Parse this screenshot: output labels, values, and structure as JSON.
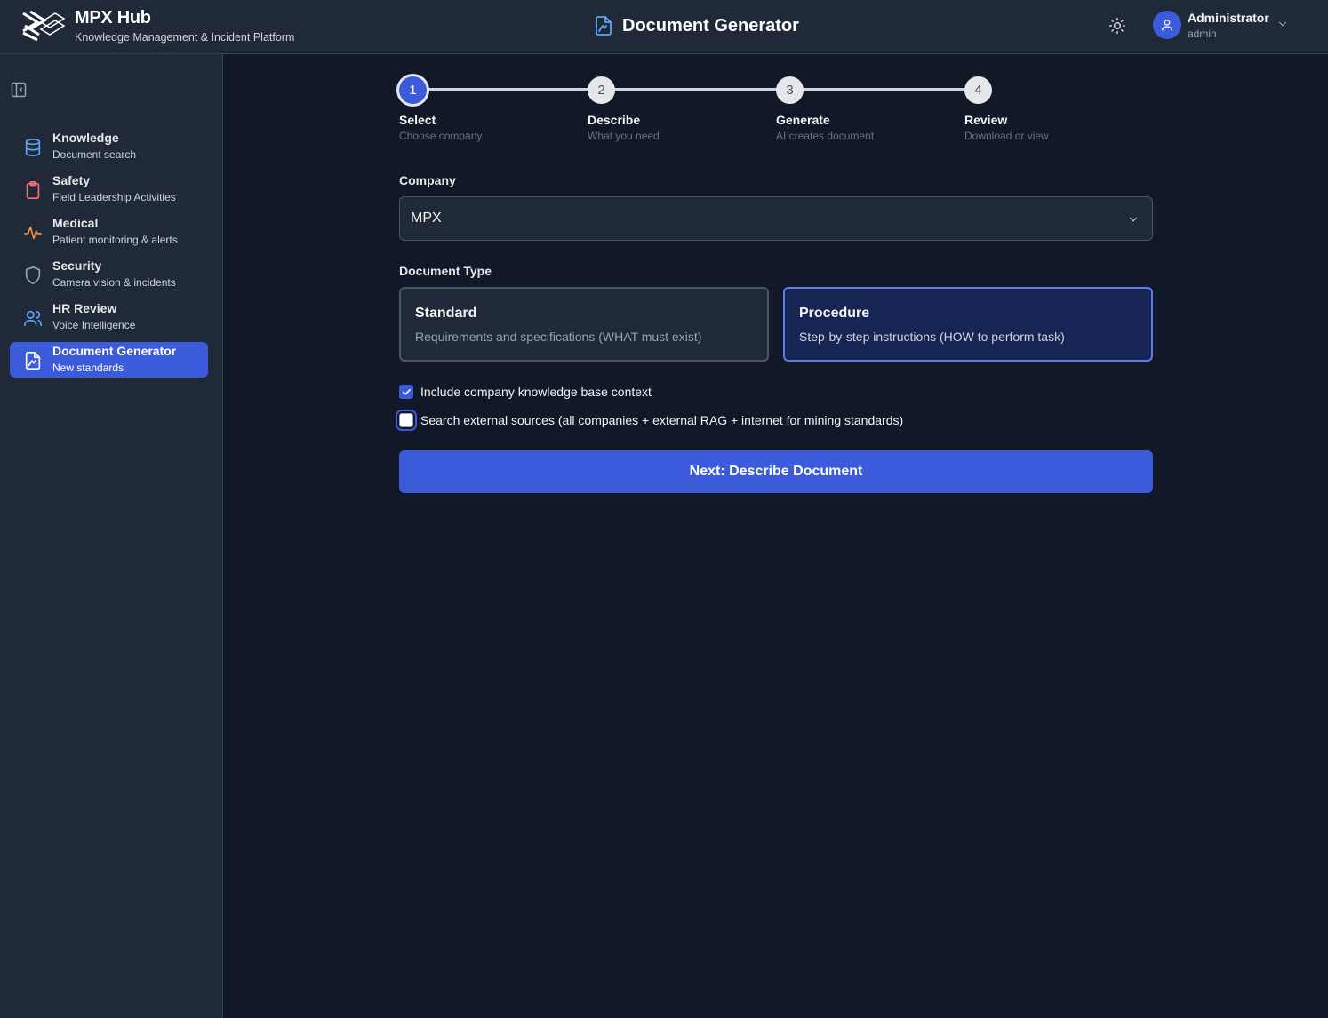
{
  "header": {
    "brand_title": "MPX Hub",
    "brand_subtitle": "Knowledge Management & Incident Platform",
    "page_title": "Document Generator",
    "user_name": "Administrator",
    "user_role": "admin"
  },
  "sidebar": {
    "items": [
      {
        "label": "Knowledge",
        "sub": "Document search",
        "icon": "database-icon",
        "color": "#60a5fa"
      },
      {
        "label": "Safety",
        "sub": "Field Leadership Activities",
        "icon": "clipboard-icon",
        "color": "#f87171"
      },
      {
        "label": "Medical",
        "sub": "Patient monitoring & alerts",
        "icon": "pulse-icon",
        "color": "#fb923c"
      },
      {
        "label": "Security",
        "sub": "Camera vision & incidents",
        "icon": "shield-icon",
        "color": "#9ca3af"
      },
      {
        "label": "HR Review",
        "sub": "Voice Intelligence",
        "icon": "users-icon",
        "color": "#60a5fa"
      },
      {
        "label": "Document Generator",
        "sub": "New standards",
        "icon": "file-signature-icon",
        "color": "#ffffff",
        "active": true
      }
    ]
  },
  "stepper": {
    "steps": [
      {
        "num": "1",
        "title": "Select",
        "sub": "Choose company",
        "active": true
      },
      {
        "num": "2",
        "title": "Describe",
        "sub": "What you need"
      },
      {
        "num": "3",
        "title": "Generate",
        "sub": "AI creates document"
      },
      {
        "num": "4",
        "title": "Review",
        "sub": "Download or view"
      }
    ]
  },
  "form": {
    "company_label": "Company",
    "company_value": "MPX",
    "doc_type_label": "Document Type",
    "types": [
      {
        "title": "Standard",
        "desc": "Requirements and specifications (WHAT must exist)",
        "selected": false
      },
      {
        "title": "Procedure",
        "desc": "Step-by-step instructions (HOW to perform task)",
        "selected": true
      }
    ],
    "include_kb_label": "Include company knowledge base context",
    "include_kb_checked": true,
    "external_label": "Search external sources (all companies + external RAG + internet for mining standards)",
    "external_checked": false,
    "next_label": "Next: Describe Document"
  },
  "colors": {
    "accent": "#3b5bdb",
    "background": "#111827",
    "panel": "#1f2937"
  }
}
